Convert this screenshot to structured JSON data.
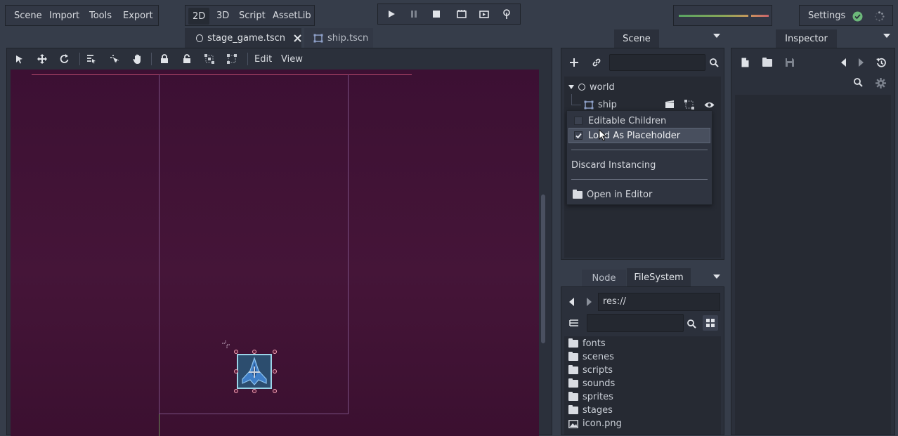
{
  "menu": {
    "scene": "Scene",
    "import": "Import",
    "tools": "Tools",
    "export": "Export"
  },
  "modes": {
    "d2": "2D",
    "d3": "3D",
    "script": "Script",
    "assetlib": "AssetLib"
  },
  "settings": "Settings",
  "scene_tabs": [
    {
      "label": "stage_game.tscn"
    },
    {
      "label": "ship.tscn"
    }
  ],
  "viewport_toolbar": {
    "edit": "Edit",
    "view": "View"
  },
  "dock_tabs": {
    "scene": "Scene",
    "inspector": "Inspector",
    "node": "Node",
    "filesystem": "FileSystem"
  },
  "tree": {
    "root": "world",
    "child": "ship"
  },
  "context_menu": {
    "editable_children": "Editable Children",
    "load_placeholder": "Load As Placeholder",
    "discard_instancing": "Discard Instancing",
    "open_in_editor": "Open in Editor"
  },
  "filesystem": {
    "path": "res://",
    "items": [
      "fonts",
      "scenes",
      "scripts",
      "sounds",
      "sprites",
      "stages",
      "icon.png"
    ]
  },
  "colors": {
    "accent": "#4f5e7a",
    "viewport_bg": "#3d1133",
    "checkmark": "#e6e8ec"
  }
}
